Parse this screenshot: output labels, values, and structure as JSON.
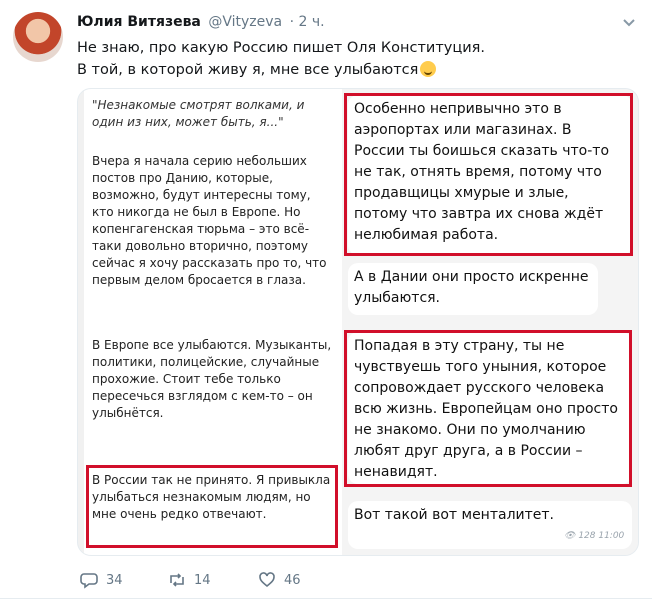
{
  "tweet": {
    "author_name": "Юлия Витязева",
    "author_handle": "@Vityzeva",
    "time": "· 2 ч.",
    "text_line1": "Не знаю, про какую Россию пишет Оля Конституция.",
    "text_line2": "В той, в которой живу я, мне все улыбаются"
  },
  "left_panel": {
    "quote": "\"Незнакомые смотрят волками, и один из них, может быть, я...\"",
    "p1": "Вчера я начала серию небольших постов про Данию, которые, возможно, будут интересны тому, кто никогда не был в Европе. Но копенгагенская тюрьма – это всё-таки довольно вторично, поэтому сейчас я хочу рассказать про то, что первым делом бросается в глаза.",
    "p2": "В Европе все улыбаются. Музыканты, политики, полицейские, случайные прохожие. Стоит тебе только пересечься взглядом с кем-то – он улыбнётся.",
    "p3": "В России так не принято. Я привыкла улыбаться незнакомым людям, но мне очень редко отвечают."
  },
  "right_panel": {
    "b1": "Особенно непривычно это в аэропортах или магазинах. В России ты боишься сказать что-то не так, отнять время, потому что продавщицы хмурые и злые, потому что завтра их снова ждёт нелюбимая работа.",
    "b2": "А в Дании они просто искренне улыбаются.",
    "b3": "Попадая в эту страну, ты не чувствуешь того уныния, которое сопровождает русского человека всю жизнь. Европейцам оно просто не знакомо. Они по умолчанию любят друг друга, а в России – ненавидят.",
    "b4": "Вот такой вот менталитет.",
    "views_time": "128 11:00"
  },
  "actions": {
    "replies": "34",
    "retweets": "14",
    "likes": "46"
  },
  "icons": [
    "chevron-down-icon",
    "reply-icon",
    "retweet-icon",
    "heart-icon",
    "eye-icon",
    "smirk-emoji-icon"
  ],
  "colors": {
    "highlight_red": "#d10f2a",
    "muted": "#657786"
  }
}
